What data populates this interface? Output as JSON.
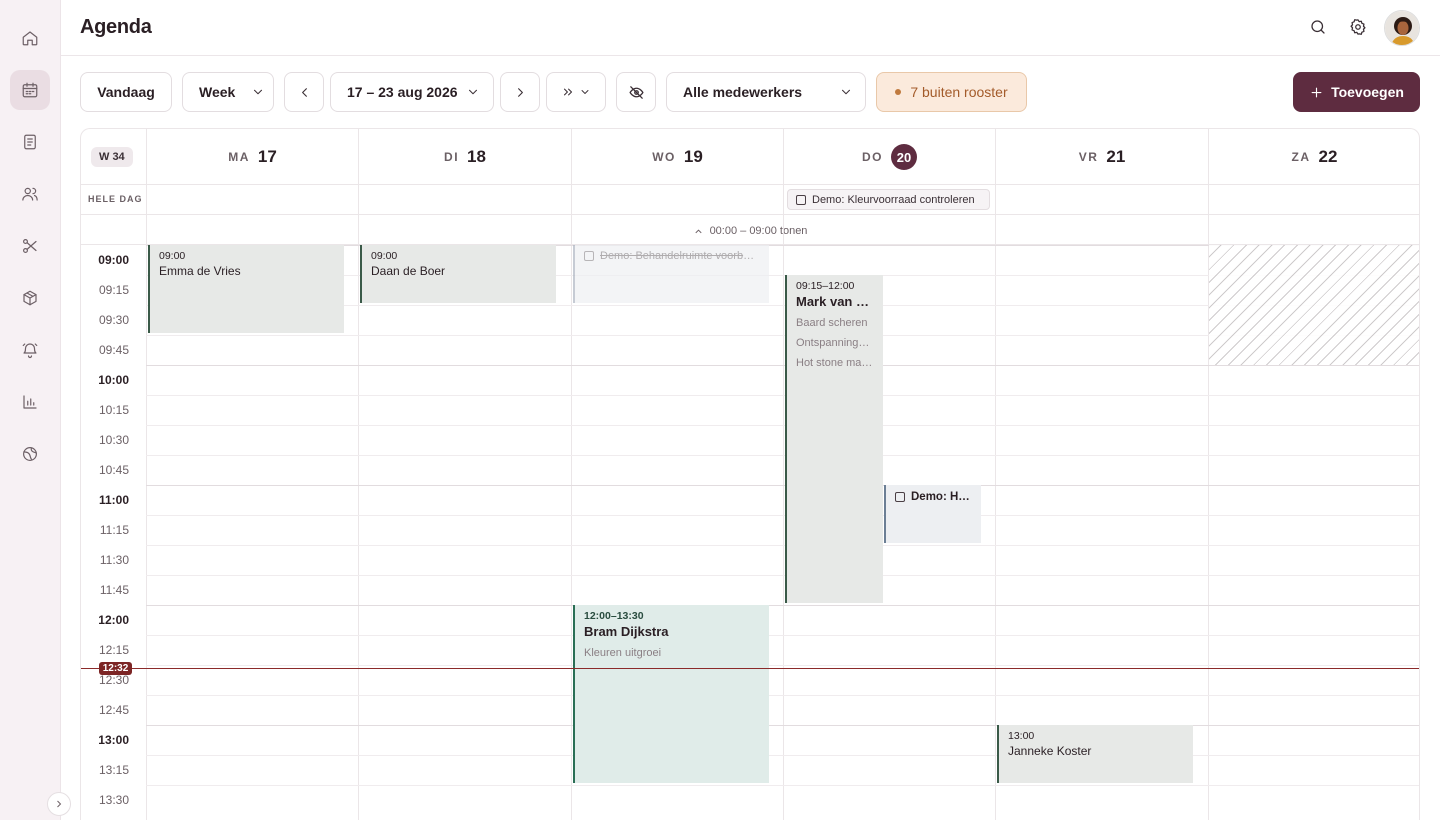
{
  "header": {
    "title": "Agenda"
  },
  "toolbar": {
    "today": "Vandaag",
    "view": "Week",
    "range": "17 – 23 aug 2026",
    "staff": "Alle medewerkers",
    "outside": "7 buiten rooster",
    "add": "Toevoegen"
  },
  "calendar": {
    "week": "W 34",
    "allday_label": "HELE DAG",
    "allday_task": "Demo: Kleurvoorraad controleren",
    "show_early": "00:00 – 09:00 tonen",
    "now": "12:32",
    "days": [
      {
        "dow": "MA",
        "num": "17"
      },
      {
        "dow": "DI",
        "num": "18"
      },
      {
        "dow": "WO",
        "num": "19"
      },
      {
        "dow": "DO",
        "num": "20"
      },
      {
        "dow": "VR",
        "num": "21"
      },
      {
        "dow": "ZA",
        "num": "22"
      }
    ],
    "slots": [
      "09:00",
      "09:15",
      "09:30",
      "09:45",
      "10:00",
      "10:15",
      "10:30",
      "10:45",
      "11:00",
      "11:15",
      "11:30",
      "11:45",
      "12:00",
      "12:15",
      "12:30",
      "12:45",
      "13:00",
      "13:15",
      "13:30"
    ],
    "events": {
      "emma": {
        "time": "09:00",
        "name": "Emma de Vries"
      },
      "daan": {
        "time": "09:00",
        "name": "Daan de Boer"
      },
      "task_wo": {
        "title": "Demo: Behandelruimte voorbereiden"
      },
      "mark": {
        "time": "09:15–12:00",
        "name": "Mark van den Berg",
        "s1": "Baard scheren",
        "s2": "Ontspanningsmassage",
        "s3": "Hot stone massage"
      },
      "task_do": {
        "title": "Demo: H…"
      },
      "bram": {
        "time": "12:00–13:30",
        "name": "Bram Dijkstra",
        "s1": "Kleuren uitgroei"
      },
      "janneke": {
        "time": "13:00",
        "name": "Janneke Koster"
      }
    }
  },
  "colors": {
    "primary": "#5e2c40",
    "warning_bg": "#fbeadc",
    "now": "#7c2525"
  }
}
